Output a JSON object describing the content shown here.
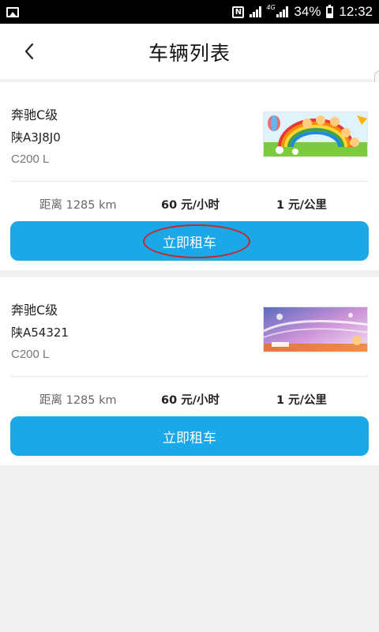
{
  "status_bar": {
    "battery_percent": "34%",
    "time": "12:32",
    "network_type": "4G",
    "nfc_label": "N",
    "icons": [
      "gallery-icon",
      "nfc-icon",
      "signal-icon",
      "signal-4g-icon",
      "battery-icon"
    ]
  },
  "header": {
    "title": "车辆列表",
    "back_icon": "chevron-left-icon"
  },
  "cars": [
    {
      "model": "奔驰C级",
      "plate": "陕A3J8J0",
      "variant": "C200 L",
      "distance": "距离 1285 km",
      "price_hour": "60 元/小时",
      "price_km": "1 元/公里",
      "button_label": "立即租车",
      "thumbnail": "rainbow-children-illustration",
      "button_highlighted": true
    },
    {
      "model": "奔驰C级",
      "plate": "陕A54321",
      "variant": "C200 L",
      "distance": "距离 1285 km",
      "price_hour": "60 元/小时",
      "price_km": "1 元/公里",
      "button_label": "立即租车",
      "thumbnail": "purple-sky-illustration",
      "button_highlighted": false
    }
  ],
  "colors": {
    "accent": "#1aa8e8",
    "highlight_ring": "#c62828",
    "background": "#f1f0f2"
  }
}
